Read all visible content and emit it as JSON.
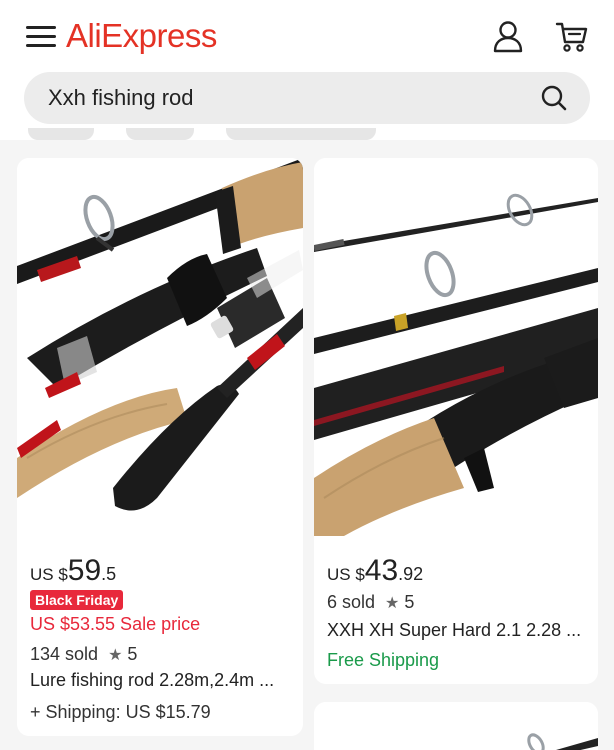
{
  "header": {
    "logo": "AliExpress",
    "menu_icon": "hamburger-menu-icon",
    "account_icon": "user-icon",
    "cart_icon": "cart-icon"
  },
  "search": {
    "query": "Xxh fishing rod",
    "icon": "search-icon"
  },
  "products": [
    {
      "currency": "US $",
      "price_whole": "59",
      "price_cents": ".5",
      "badge": "Black Friday",
      "sale_price": "US $53.55 Sale price",
      "sold": "134 sold",
      "rating": "5",
      "title": "Lure fishing rod 2.28m,2.4m ...",
      "shipping": "+ Shipping: US $15.79"
    },
    {
      "currency": "US $",
      "price_whole": "43",
      "price_cents": ".92",
      "sold": "6 sold",
      "rating": "5",
      "title": "XXH XH Super Hard 2.1 2.28 ...",
      "shipping": "Free Shipping"
    }
  ],
  "colors": {
    "brand": "#e43225",
    "sale": "#e8283b",
    "free_shipping": "#1a9a4a"
  }
}
